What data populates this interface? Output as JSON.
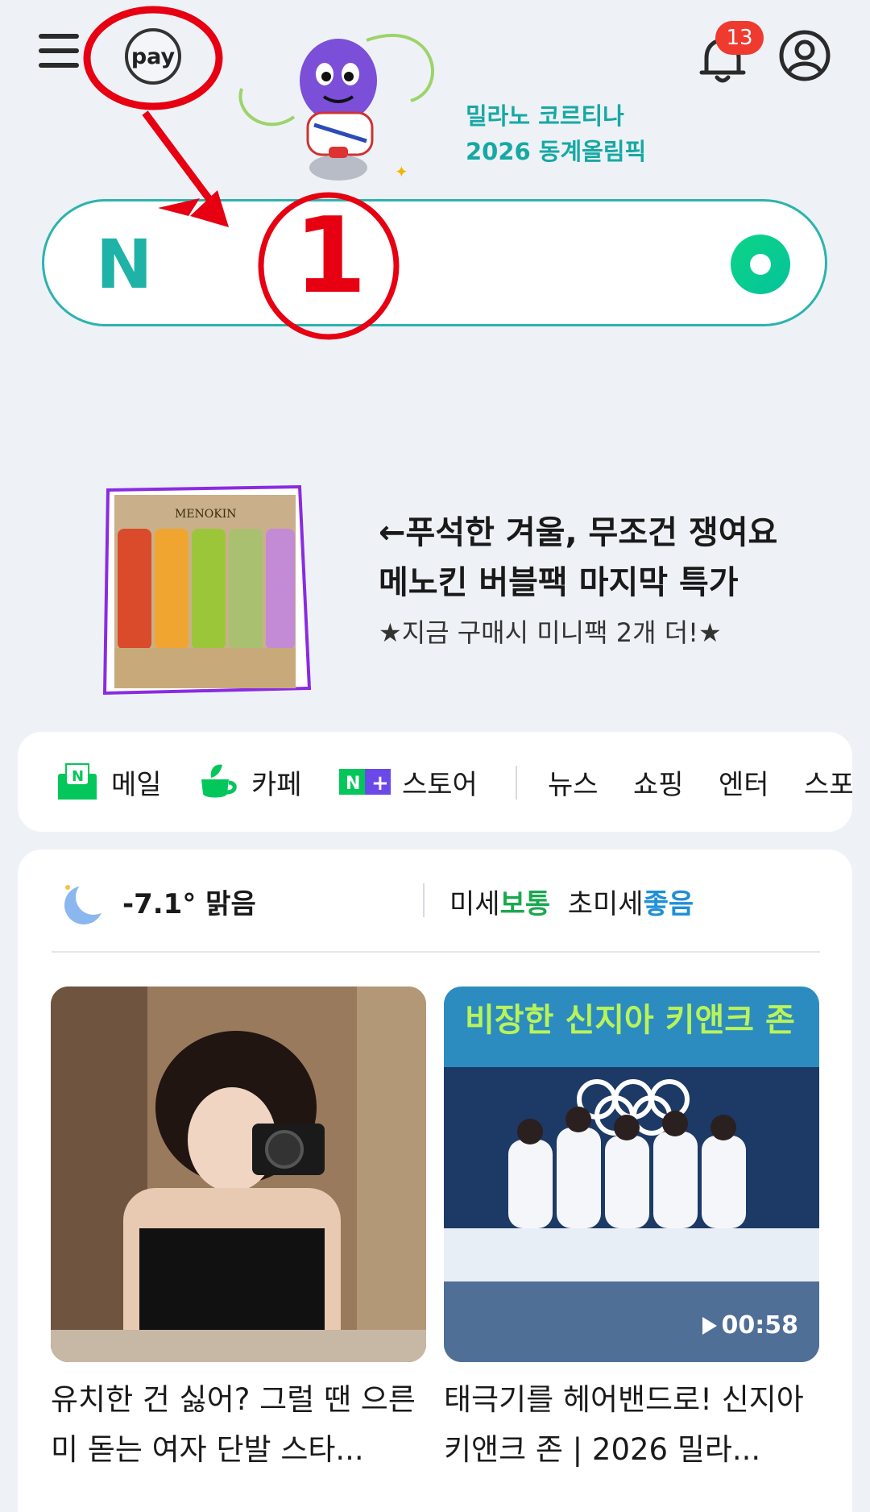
{
  "header": {
    "pay_label": "pay",
    "promo_line1": "밀라노 코르티나",
    "promo_line2": "2026 동계올림픽",
    "notification_count": "13"
  },
  "search": {
    "logo": "N",
    "placeholder": ""
  },
  "annotation": {
    "marker": "1"
  },
  "ad": {
    "line1": "←푸석한 겨울, 무조건 쟁여요",
    "line2": "메노킨 버블팩 마지막 특가",
    "line3": "★지금 구매시 미니팩 2개 더!★",
    "brand": "MENOKIN"
  },
  "services": [
    {
      "label": "메일",
      "icon": "mail-icon"
    },
    {
      "label": "카페",
      "icon": "cafe-icon"
    },
    {
      "label": "스토어",
      "icon": "store-icon"
    },
    {
      "label": "뉴스"
    },
    {
      "label": "쇼핑"
    },
    {
      "label": "엔터"
    },
    {
      "label": "스포"
    }
  ],
  "weather": {
    "icon": "moon-icon",
    "temp": "-7.1° 맑음",
    "fine_dust_label": "미세",
    "fine_dust_value": "보통",
    "ultrafine_dust_label": "초미세",
    "ultrafine_dust_value": "좋음"
  },
  "cards": [
    {
      "caption": "유치한 건 싫어? 그럴 땐 으른미 돋는 여자 단발 스타..."
    },
    {
      "overlay_title": "비장한 신지아 키앤크 존",
      "duration": "00:58",
      "caption": "태극기를 헤어밴드로! 신지아 키앤크 존 | 2026 밀라..."
    }
  ],
  "colors": {
    "accent_teal": "#2db3ae",
    "naver_green": "#03c75a",
    "badge_red": "#ef3b2f",
    "annotation_red": "#e60012"
  }
}
